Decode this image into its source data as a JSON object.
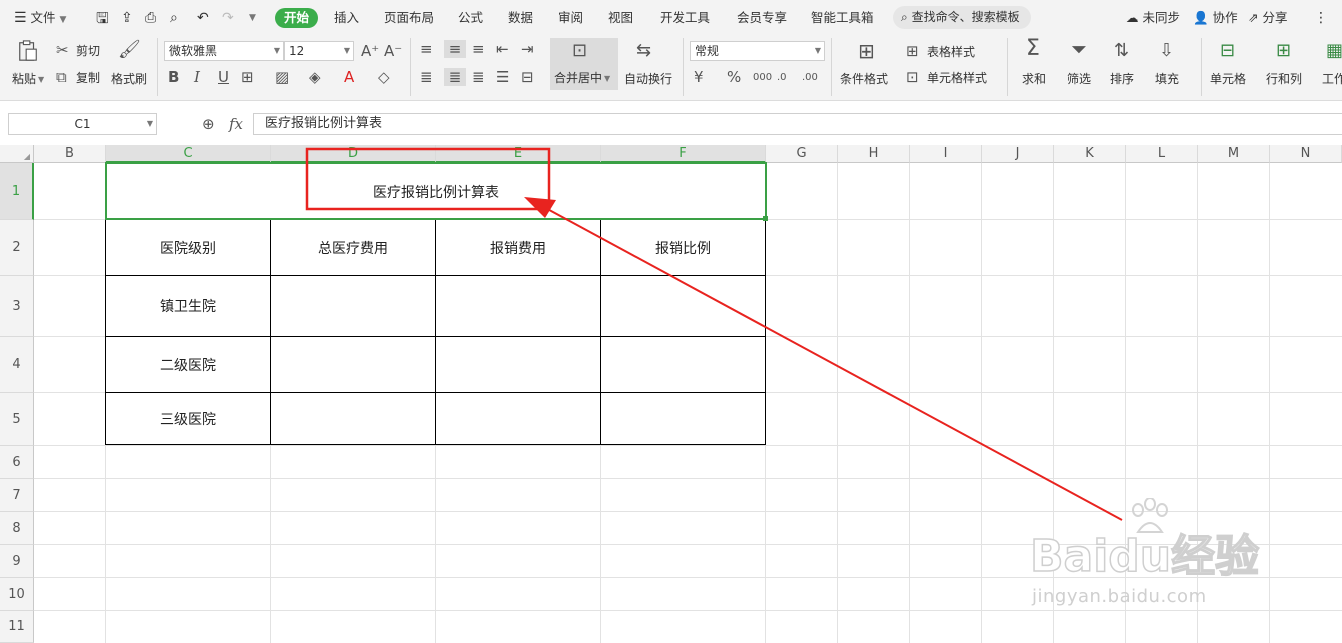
{
  "menubar": {
    "file": "文件",
    "tabs": [
      "开始",
      "插入",
      "页面布局",
      "公式",
      "数据",
      "审阅",
      "视图",
      "开发工具",
      "会员专享",
      "智能工具箱"
    ],
    "search_placeholder": "查找命令、搜索模板",
    "sync": "未同步",
    "collab": "协作",
    "share": "分享"
  },
  "ribbon": {
    "paste": "粘贴",
    "cut": "剪切",
    "copy": "复制",
    "format_painter": "格式刷",
    "font_name": "微软雅黑",
    "font_size": "12",
    "merge_center": "合并居中",
    "wrap_text": "自动换行",
    "number_format": "常规",
    "conditional_format": "条件格式",
    "table_style": "表格样式",
    "cell_style": "单元格样式",
    "sum": "求和",
    "filter": "筛选",
    "sort": "排序",
    "fill": "填充",
    "cell": "单元格",
    "row_col": "行和列",
    "worksheet": "工作"
  },
  "formula": {
    "name_box": "C1",
    "fx": "fx",
    "content": "医疗报销比例计算表"
  },
  "sheet": {
    "columns": [
      "B",
      "C",
      "D",
      "E",
      "F",
      "G",
      "H",
      "I",
      "J",
      "K",
      "L",
      "M",
      "N"
    ],
    "rows": [
      "1",
      "2",
      "3",
      "4",
      "5",
      "6",
      "7",
      "8",
      "9",
      "10",
      "11"
    ],
    "title": "医疗报销比例计算表",
    "headers": [
      "医院级别",
      "总医疗费用",
      "报销费用",
      "报销比例"
    ],
    "levels": [
      "镇卫生院",
      "二级医院",
      "三级医院"
    ]
  },
  "watermark": {
    "brand": "Baidu经验",
    "url": "jingyan.baidu.com"
  },
  "colors": {
    "accent": "#3bad4b",
    "annotation": "#e8231f"
  }
}
